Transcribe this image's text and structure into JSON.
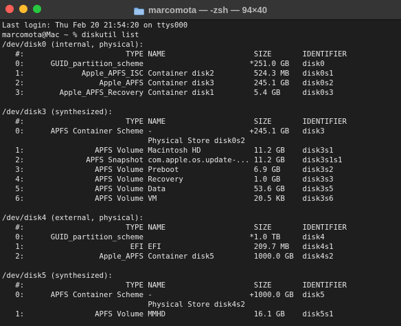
{
  "window": {
    "title": "marcomota — -zsh — 94×40",
    "folder_icon": "folder-icon",
    "traffic_colors": {
      "close": "#ff5f57",
      "minimize": "#febc2e",
      "zoom": "#28c840"
    }
  },
  "terminal": {
    "lines": [
      "Last login: Thu Feb 20 21:54:20 on ttys000",
      "marcomota@Mac ~ % diskutil list",
      "/dev/disk0 (internal, physical):",
      "   #:                       TYPE NAME                    SIZE       IDENTIFIER",
      "   0:      GUID_partition_scheme                        *251.0 GB   disk0",
      "   1:             Apple_APFS_ISC Container disk2         524.3 MB   disk0s1",
      "   2:                 Apple_APFS Container disk3         245.1 GB   disk0s2",
      "   3:        Apple_APFS_Recovery Container disk1         5.4 GB     disk0s3",
      "",
      "/dev/disk3 (synthesized):",
      "   #:                       TYPE NAME                    SIZE       IDENTIFIER",
      "   0:      APFS Container Scheme -                      +245.1 GB   disk3",
      "                                 Physical Store disk0s2",
      "   1:                APFS Volume Macintosh HD            11.2 GB    disk3s1",
      "   2:              APFS Snapshot com.apple.os.update-... 11.2 GB    disk3s1s1",
      "   3:                APFS Volume Preboot                 6.9 GB     disk3s2",
      "   4:                APFS Volume Recovery                1.0 GB     disk3s3",
      "   5:                APFS Volume Data                    53.6 GB    disk3s5",
      "   6:                APFS Volume VM                      20.5 KB    disk3s6",
      "",
      "/dev/disk4 (external, physical):",
      "   #:                       TYPE NAME                    SIZE       IDENTIFIER",
      "   0:      GUID_partition_scheme                        *1.0 TB     disk4",
      "   1:                        EFI EFI                     209.7 MB   disk4s1",
      "   2:                 Apple_APFS Container disk5         1000.0 GB  disk4s2",
      "",
      "/dev/disk5 (synthesized):",
      "   #:                       TYPE NAME                    SIZE       IDENTIFIER",
      "   0:      APFS Container Scheme -                      +1000.0 GB  disk5",
      "                                 Physical Store disk4s2",
      "   1:                APFS Volume MMHD                    16.1 GB    disk5s1"
    ]
  }
}
